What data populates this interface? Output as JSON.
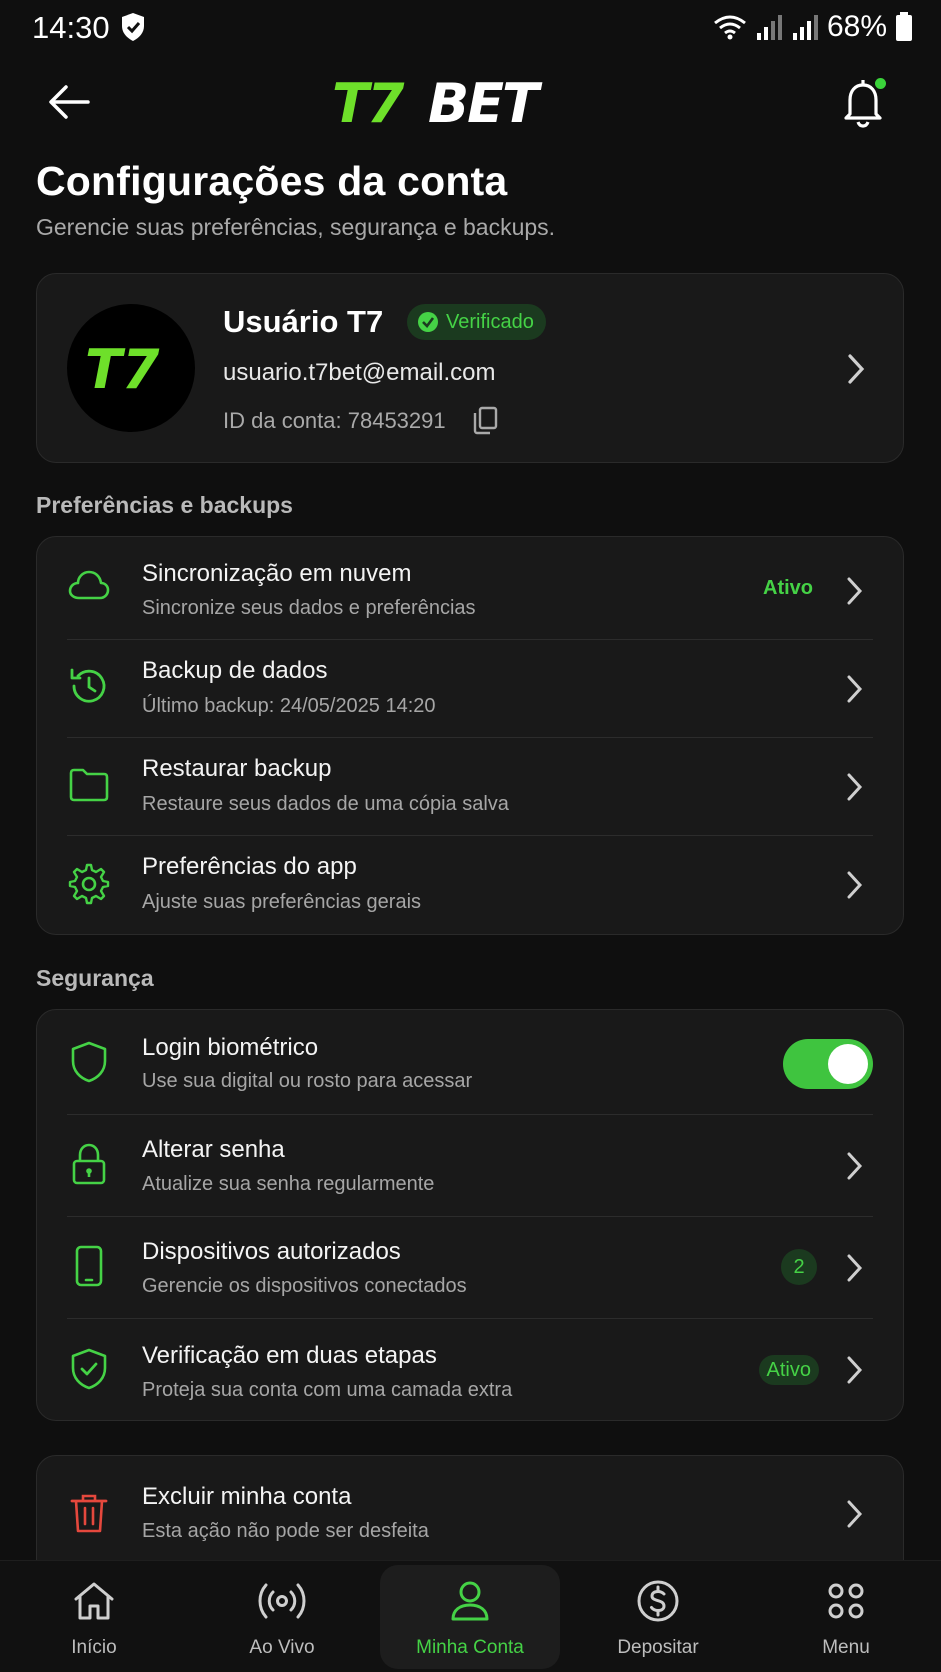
{
  "status_bar": {
    "time": "14:30",
    "battery": "68%"
  },
  "header": {
    "logo_text": "T7BET"
  },
  "page": {
    "title": "Configurações da conta",
    "subtitle": "Gerencie suas preferências, segurança e backups."
  },
  "profile": {
    "avatar_text": "T7",
    "name": "Usuário T7",
    "verified_label": "Verificado",
    "email": "usuario.t7bet@email.com",
    "account_id": "ID da conta: 78453291"
  },
  "sections": {
    "prefs_title": "Preferências e backups",
    "security_title": "Segurança"
  },
  "prefs": [
    {
      "title": "Sincronização em nuvem",
      "subtitle": "Sincronize seus dados e preferências",
      "status": "Ativo",
      "icon": "cloud-icon"
    },
    {
      "title": "Backup de dados",
      "subtitle": "Último backup: 24/05/2025 14:20",
      "icon": "history-icon"
    },
    {
      "title": "Restaurar backup",
      "subtitle": "Restaure seus dados de uma cópia salva",
      "icon": "folder-icon"
    },
    {
      "title": "Preferências do app",
      "subtitle": "Ajuste suas preferências gerais",
      "icon": "gear-icon"
    }
  ],
  "security": [
    {
      "title": "Login biométrico",
      "subtitle": "Use sua digital ou rosto para acessar",
      "toggle_on": true,
      "icon": "shield-icon"
    },
    {
      "title": "Alterar senha",
      "subtitle": "Atualize sua senha regularmente",
      "icon": "lock-icon"
    },
    {
      "title": "Dispositivos autorizados",
      "subtitle": "Gerencie os dispositivos conectados",
      "count": "2",
      "icon": "phone-icon"
    },
    {
      "title": "Verificação em duas etapas",
      "subtitle": "Proteja sua conta com uma camada extra",
      "status": "Ativo",
      "icon": "shield-check-icon"
    }
  ],
  "danger": {
    "title": "Excluir minha conta",
    "subtitle": "Esta ação não pode ser desfeita",
    "icon": "trash-icon"
  },
  "nav": [
    {
      "label": "Início",
      "icon": "home-icon"
    },
    {
      "label": "Ao Vivo",
      "icon": "live-icon"
    },
    {
      "label": "Minha Conta",
      "icon": "user-icon",
      "active": true
    },
    {
      "label": "Depositar",
      "icon": "dollar-icon"
    },
    {
      "label": "Menu",
      "icon": "grid-icon"
    }
  ],
  "colors": {
    "accent": "#45d246",
    "background": "#0f0f0f",
    "card": "#191919",
    "danger": "#e5483d"
  }
}
